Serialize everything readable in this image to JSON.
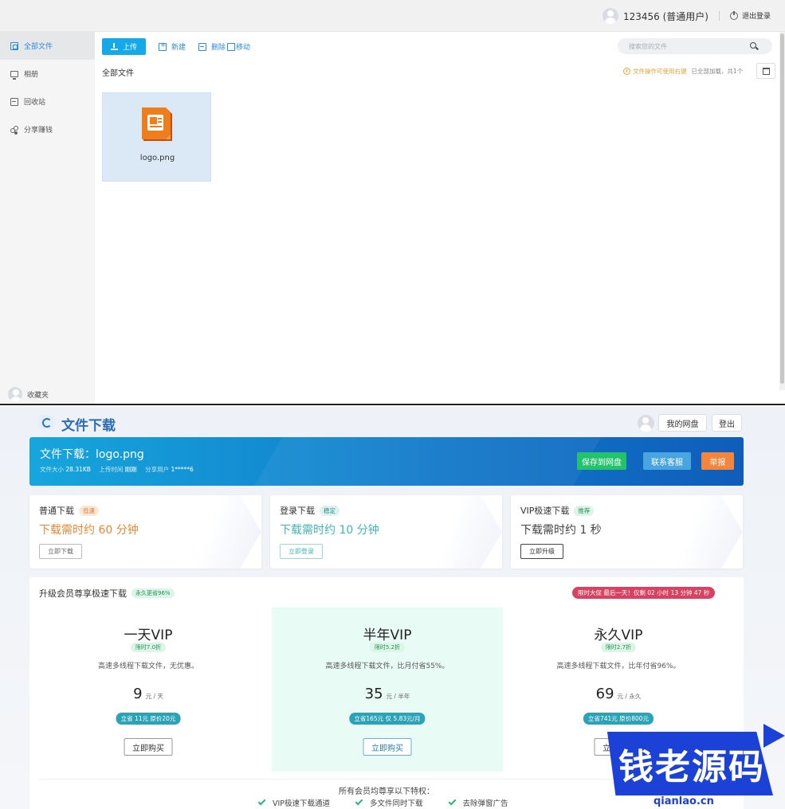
{
  "file_manager": {
    "user_name": "123456 (普通用户)",
    "logout_label": "退出登录",
    "sidebar": {
      "items": [
        {
          "label": "全部文件",
          "icon": "files-icon",
          "active": true
        },
        {
          "label": "相册",
          "icon": "monitor-icon",
          "active": false
        },
        {
          "label": "回收站",
          "icon": "trash-icon",
          "active": false
        },
        {
          "label": "分享赚钱",
          "icon": "share-icon",
          "active": false
        }
      ],
      "favorites_label": "收藏夹"
    },
    "toolbar": {
      "upload_label": "上传",
      "new_label": "新建",
      "delete_label": "删除",
      "move_label": "移动"
    },
    "search": {
      "placeholder": "搜索您的文件"
    },
    "breadcrumb": "全部文件",
    "tips": {
      "hint": "文件操作可使用右键",
      "status": "已全部加载，共1个"
    },
    "files": [
      {
        "name": "logo.png",
        "icon": "ppt-file-icon"
      }
    ],
    "accent_color": "#14a9e8"
  },
  "download_page": {
    "title": "文件下载",
    "header": {
      "mydisk_label": "我的网盘",
      "login_label": "登出"
    },
    "banner": {
      "file_line": "文件下载：logo.png",
      "size_label": "文件大小",
      "size_value": "28.31KB",
      "upload_time_label": "上传时间",
      "upload_time_value": "刚刚",
      "share_user_label": "分享用户",
      "share_user_value": "1*****6",
      "save_label": "保存到网盘",
      "service_label": "联系客服",
      "report_label": "举报"
    },
    "speed_cards": [
      {
        "title": "普通下载",
        "badge": "低速",
        "time": "下载需时约 60 分钟",
        "button": "立即下载"
      },
      {
        "title": "登录下载",
        "badge": "稳定",
        "time": "下载需时约 10 分钟",
        "button": "立即登录"
      },
      {
        "title": "VIP极速下载",
        "badge": "推荐",
        "time": "下载需时约 1 秒",
        "button": "立即升级"
      }
    ],
    "vip": {
      "title": "升级会员尊享极速下载",
      "save_badge": "永久更省96%",
      "promo": "限时大促 最后一天！仅剩 02 小时 13 分钟 47 秒",
      "plans": [
        {
          "name": "一天VIP",
          "discount": "限时7.0折",
          "desc": "高速多线程下载文件，无优惠。",
          "price": "9",
          "unit": "元 / 天",
          "save": "立省 11元 原价20元",
          "buy": "立即购买"
        },
        {
          "name": "半年VIP",
          "discount": "限时5.2折",
          "desc": "高速多线程下载文件，比月付省55%。",
          "price": "35",
          "unit": "元 / 半年",
          "save": "立省165元 仅 5.83元/月",
          "buy": "立即购买"
        },
        {
          "name": "永久VIP",
          "discount": "限时2.7折",
          "desc": "高速多线程下载文件，比年付省96%。",
          "price": "69",
          "unit": "元 / 永久",
          "save": "立省741元 原价800元",
          "buy": "立即购买"
        }
      ],
      "perks_title": "所有会员均尊享以下特权：",
      "perks": [
        "VIP极速下载通道",
        "多文件同时下载",
        "去除弹窗广告"
      ]
    }
  },
  "watermark": {
    "title": "钱老源码",
    "url": "qianlao.cn"
  }
}
